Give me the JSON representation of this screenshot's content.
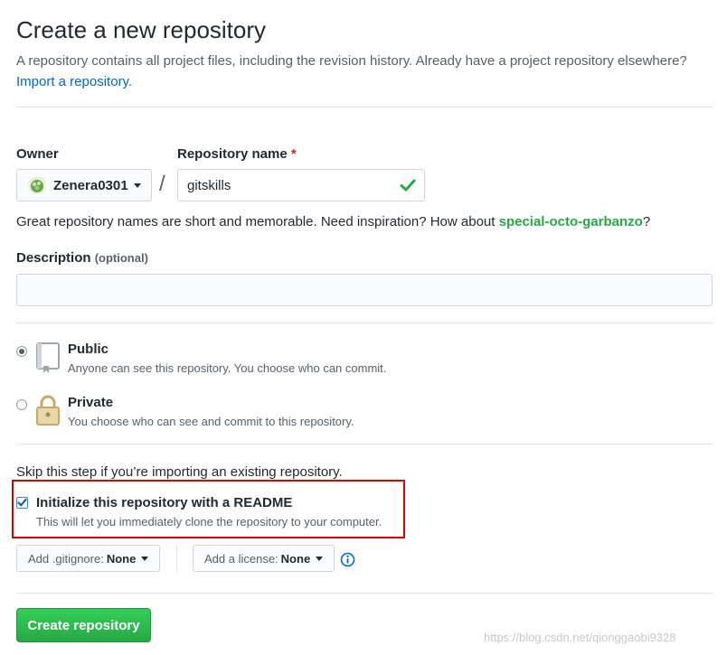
{
  "header": {
    "title": "Create a new repository",
    "subtitle": "A repository contains all project files, including the revision history. Already have a project repository elsewhere?",
    "import_link": "Import a repository."
  },
  "owner": {
    "label": "Owner",
    "value": "Zenera0301"
  },
  "repo_name": {
    "label": "Repository name",
    "required_mark": "*",
    "value": "gitskills",
    "separator": "/"
  },
  "suggestion": {
    "prefix": "Great repository names are short and memorable. Need inspiration? How about ",
    "name": "special-octo-garbanzo",
    "suffix": "?"
  },
  "description": {
    "label": "Description",
    "optional": "(optional)",
    "value": ""
  },
  "visibility": {
    "selected": "public",
    "public": {
      "title": "Public",
      "note": "Anyone can see this repository. You choose who can commit."
    },
    "private": {
      "title": "Private",
      "note": "You choose who can see and commit to this repository."
    }
  },
  "init": {
    "skip_text": "Skip this step if you’re importing an existing repository.",
    "readme_label": "Initialize this repository with a README",
    "readme_note": "This will let you immediately clone the repository to your computer.",
    "readme_checked": true
  },
  "gitignore": {
    "label": "Add .gitignore:",
    "value": "None"
  },
  "license": {
    "label": "Add a license:",
    "value": "None"
  },
  "create_button": "Create repository",
  "watermark": "https://blog.csdn.net/qionggaobi9328",
  "colors": {
    "accent_link": "#0366d6",
    "success": "#28a745",
    "highlight_box": "#e00000"
  }
}
